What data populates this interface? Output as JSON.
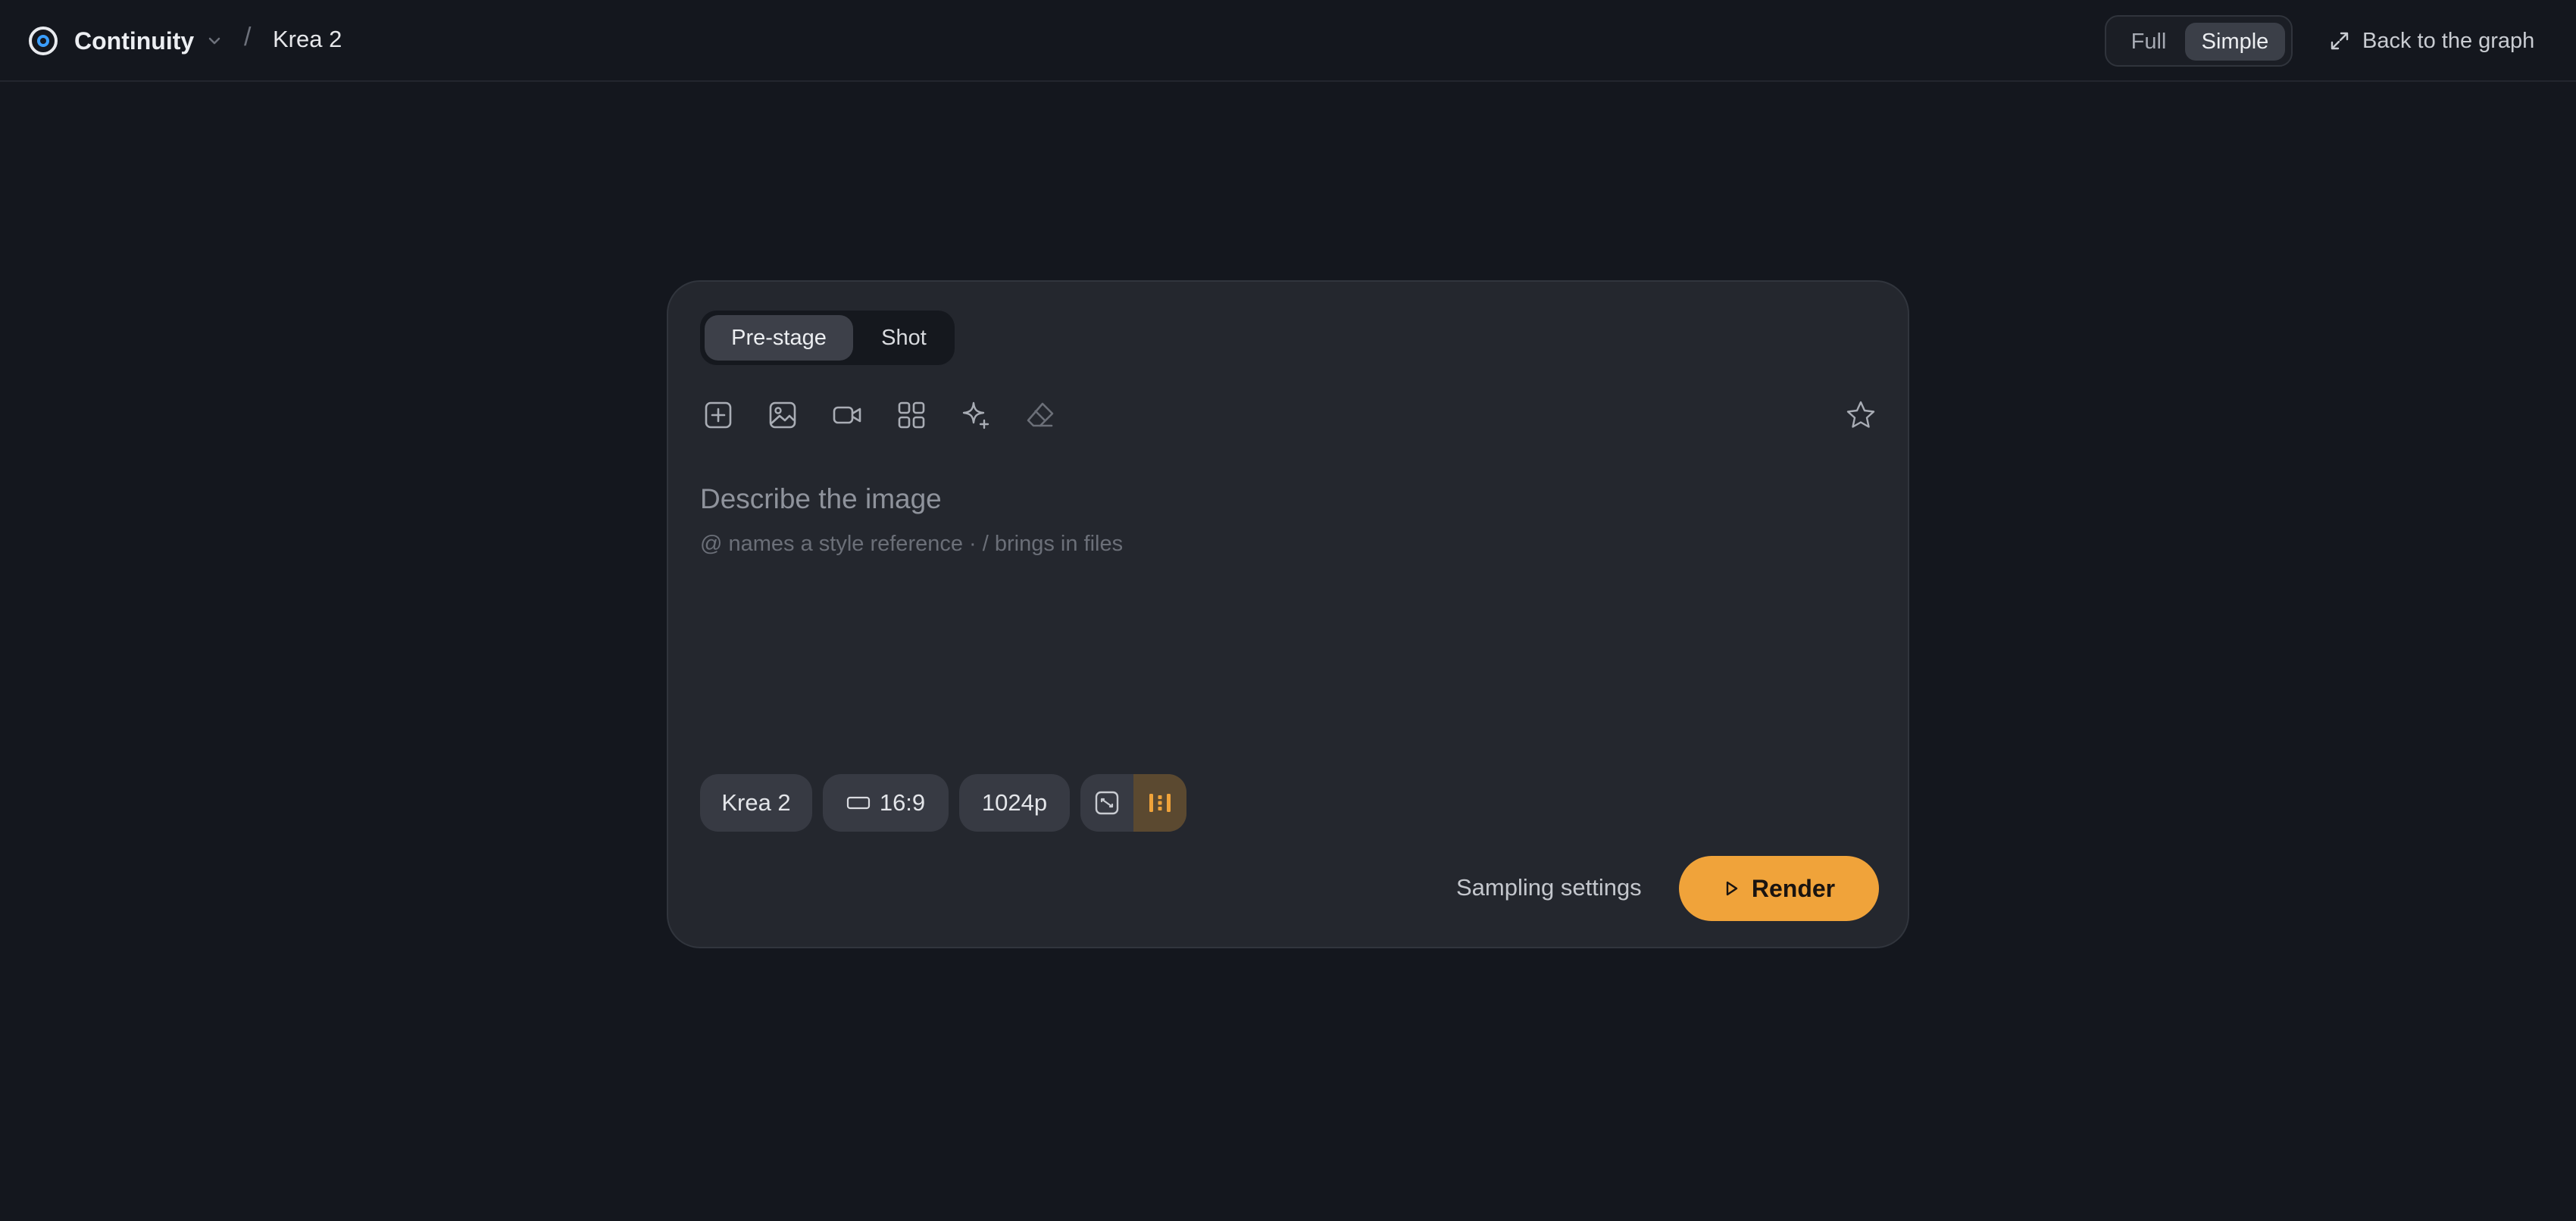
{
  "header": {
    "app_name": "Continuity",
    "breadcrumb_separator": "/",
    "page_title": "Krea 2",
    "icons": {
      "logo": "continuity-logo",
      "menu": "chevron-down-icon"
    },
    "view_modes": [
      {
        "label": "Full",
        "selected": false
      },
      {
        "label": "Simple",
        "selected": true
      }
    ],
    "back_link": {
      "label": "Back to the graph",
      "icon": "expand-arrows-icon"
    }
  },
  "composer": {
    "tabs": [
      {
        "label": "Pre-stage",
        "selected": true
      },
      {
        "label": "Shot",
        "selected": false
      }
    ],
    "tools": [
      {
        "icon": "add-box-icon"
      },
      {
        "icon": "image-icon"
      },
      {
        "icon": "video-camera-icon"
      },
      {
        "icon": "grid-icon"
      },
      {
        "icon": "sparkle-icon"
      },
      {
        "icon": "eraser-icon",
        "disabled": true
      },
      {
        "icon": "star-icon"
      }
    ],
    "prompt_placeholder": "Describe the image",
    "prompt_hint": "@ names a style reference · / brings in files",
    "chips": {
      "model": "Krea 2",
      "aspect_ratio": "16:9",
      "aspect_icon": "landscape-frame-icon",
      "resolution": "1024p",
      "option_a_icon": "scale-frame-icon",
      "option_b_icon": "bars-icon",
      "option_b_active": true
    },
    "sampling_settings": "Sampling settings",
    "render": {
      "label": "Render",
      "icon": "play-icon"
    }
  },
  "colors": {
    "background": "#14171e",
    "card": "#24272e",
    "accent": "#f0a33a"
  }
}
